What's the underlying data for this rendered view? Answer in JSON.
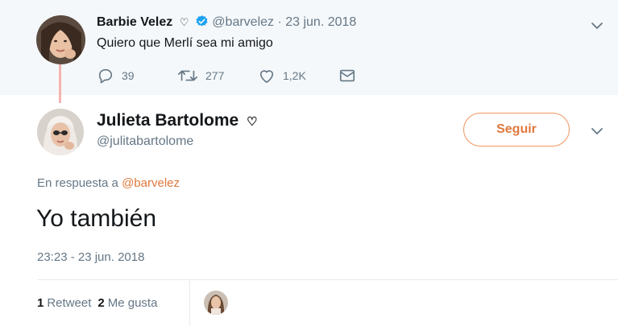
{
  "parent_tweet": {
    "name": "Barbie Velez",
    "heart": "♡",
    "handle": "@barvelez",
    "separator": " · ",
    "date": "23 jun. 2018",
    "text": "Quiero que Merlí sea mi amigo",
    "replies": "39",
    "retweets": "277",
    "likes": "1,2K"
  },
  "main_tweet": {
    "name": "Julieta Bartolome",
    "heart": "♡",
    "handle": "@julitabartolome",
    "follow_label": "Seguir",
    "reply_prefix": "En respuesta a ",
    "reply_mention": "@barvelez",
    "text": "Yo también",
    "timestamp": "23:23 - 23 jun. 2018",
    "retweet_count": "1",
    "retweet_label": "Retweet",
    "like_count": "2",
    "like_label": "Me gusta"
  },
  "colors": {
    "accent": "#e0793d",
    "verified": "#1da1f2",
    "muted": "#657786",
    "parent_bg": "#f5f8fa"
  },
  "icons": [
    "verified-icon",
    "reply-icon",
    "retweet-icon",
    "like-icon",
    "dm-icon",
    "chevron-down-icon"
  ]
}
